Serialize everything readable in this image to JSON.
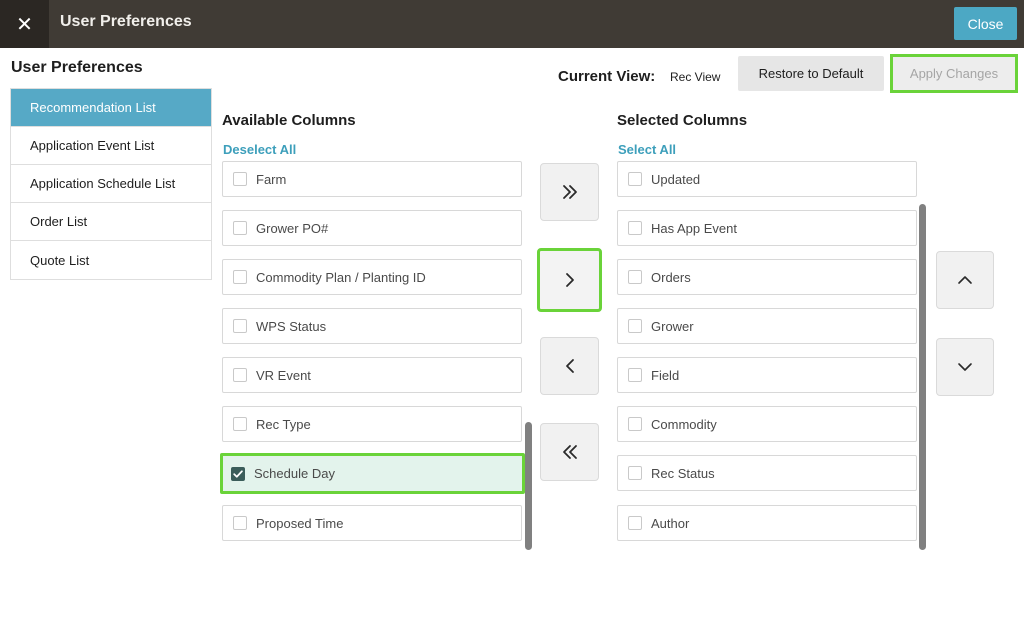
{
  "header": {
    "title": "User Preferences",
    "close_icon_glyph": "✕",
    "close_label": "Close"
  },
  "sidebar": {
    "title": "User Preferences",
    "items": [
      {
        "label": "Recommendation List",
        "active": true
      },
      {
        "label": "Application Event List",
        "active": false
      },
      {
        "label": "Application Schedule List",
        "active": false
      },
      {
        "label": "Order List",
        "active": false
      },
      {
        "label": "Quote List",
        "active": false
      }
    ]
  },
  "current_view": {
    "label": "Current View:",
    "value": "Rec View",
    "restore_label": "Restore to Default",
    "apply_label": "Apply Changes"
  },
  "available": {
    "heading": "Available Columns",
    "link": "Deselect All",
    "items": [
      {
        "label": "Farm",
        "checked": false
      },
      {
        "label": "Grower PO#",
        "checked": false
      },
      {
        "label": "Commodity Plan / Planting ID",
        "checked": false
      },
      {
        "label": "WPS Status",
        "checked": false
      },
      {
        "label": "VR Event",
        "checked": false
      },
      {
        "label": "Rec Type",
        "checked": false
      },
      {
        "label": "Schedule Day",
        "checked": true
      },
      {
        "label": "Proposed Time",
        "checked": false
      }
    ]
  },
  "selected": {
    "heading": "Selected Columns",
    "link": "Select All",
    "items": [
      {
        "label": "Updated",
        "checked": false
      },
      {
        "label": "Has App Event",
        "checked": false
      },
      {
        "label": "Orders",
        "checked": false
      },
      {
        "label": "Grower",
        "checked": false
      },
      {
        "label": "Field",
        "checked": false
      },
      {
        "label": "Commodity",
        "checked": false
      },
      {
        "label": "Rec Status",
        "checked": false
      },
      {
        "label": "Author",
        "checked": false
      }
    ]
  },
  "icons": {
    "move_all_right": "double-chevron-right-icon",
    "move_right": "chevron-right-icon",
    "move_left": "chevron-left-icon",
    "move_all_left": "double-chevron-left-icon",
    "move_up": "chevron-up-icon",
    "move_down": "chevron-down-icon"
  },
  "colors": {
    "header_bg": "#403b35",
    "accent": "#56a9c6",
    "highlight": "#6ad339",
    "checked_bg": "#e3f3ec"
  }
}
